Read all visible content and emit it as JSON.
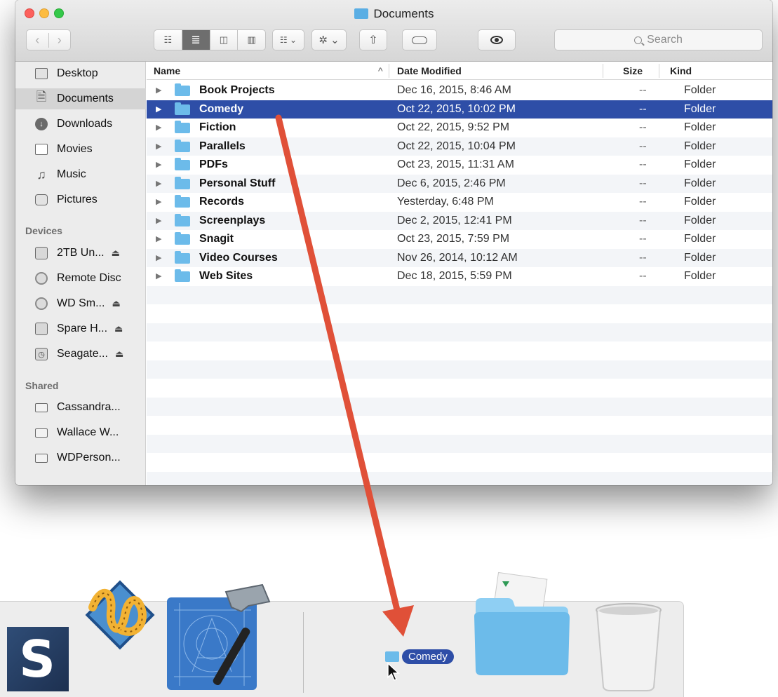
{
  "window": {
    "title": "Documents",
    "nav": {
      "back": "‹",
      "forward": "›"
    },
    "toolbar": {
      "view_icon": "☷",
      "list_icon": "≣",
      "column_icon": "◫",
      "cover_icon": "▥",
      "arrange": "☷ ⌄",
      "action": "✲ ⌄",
      "share": "⇧"
    },
    "search": {
      "placeholder": "Search"
    }
  },
  "sidebar": {
    "favorites": [
      {
        "label": "Desktop",
        "icon": "desktop-icon",
        "selected": false
      },
      {
        "label": "Documents",
        "icon": "documents-icon",
        "selected": true
      },
      {
        "label": "Downloads",
        "icon": "downloads-icon",
        "selected": false
      },
      {
        "label": "Movies",
        "icon": "movies-icon",
        "selected": false
      },
      {
        "label": "Music",
        "icon": "music-icon",
        "selected": false
      },
      {
        "label": "Pictures",
        "icon": "pictures-icon",
        "selected": false
      }
    ],
    "devices_header": "Devices",
    "devices": [
      {
        "label": "2TB Un...",
        "icon": "hard-drive-icon",
        "eject": "⏏"
      },
      {
        "label": "Remote Disc",
        "icon": "disc-icon",
        "eject": ""
      },
      {
        "label": "WD Sm...",
        "icon": "disc-icon",
        "eject": "⏏"
      },
      {
        "label": "Spare H...",
        "icon": "hard-drive-icon",
        "eject": "⏏"
      },
      {
        "label": "Seagate...",
        "icon": "time-machine-icon",
        "eject": "⏏"
      }
    ],
    "shared_header": "Shared",
    "shared": [
      {
        "label": "Cassandra...",
        "icon": "computer-icon"
      },
      {
        "label": "Wallace W...",
        "icon": "computer-icon"
      },
      {
        "label": "WDPerson...",
        "icon": "computer-icon"
      }
    ]
  },
  "list": {
    "columns": {
      "name": "Name",
      "date": "Date Modified",
      "size": "Size",
      "kind": "Kind",
      "sort_indicator": "^"
    },
    "rows": [
      {
        "name": "Book Projects",
        "date": "Dec 16, 2015, 8:46 AM",
        "size": "--",
        "kind": "Folder"
      },
      {
        "name": "Comedy",
        "date": "Oct 22, 2015, 10:02 PM",
        "size": "--",
        "kind": "Folder",
        "selected": true
      },
      {
        "name": "Fiction",
        "date": "Oct 22, 2015, 9:52 PM",
        "size": "--",
        "kind": "Folder"
      },
      {
        "name": "Parallels",
        "date": "Oct 22, 2015, 10:04 PM",
        "size": "--",
        "kind": "Folder"
      },
      {
        "name": "PDFs",
        "date": "Oct 23, 2015, 11:31 AM",
        "size": "--",
        "kind": "Folder"
      },
      {
        "name": "Personal Stuff",
        "date": "Dec 6, 2015, 2:46 PM",
        "size": "--",
        "kind": "Folder"
      },
      {
        "name": "Records",
        "date": "Yesterday, 6:48 PM",
        "size": "--",
        "kind": "Folder"
      },
      {
        "name": "Screenplays",
        "date": "Dec 2, 2015, 12:41 PM",
        "size": "--",
        "kind": "Folder"
      },
      {
        "name": "Snagit",
        "date": "Oct 23, 2015, 7:59 PM",
        "size": "--",
        "kind": "Folder"
      },
      {
        "name": "Video Courses",
        "date": "Nov 26, 2014, 10:12 AM",
        "size": "--",
        "kind": "Folder"
      },
      {
        "name": "Web Sites",
        "date": "Dec 18, 2015, 5:59 PM",
        "size": "--",
        "kind": "Folder"
      }
    ],
    "empty_rows": 11
  },
  "dock": {
    "apps": [
      {
        "name": "snagit-icon",
        "glyph": "S"
      },
      {
        "name": "wow-icon"
      },
      {
        "name": "xcode-icon"
      }
    ],
    "drag_label": "Comedy",
    "stack": "documents-stack-icon",
    "trash": "trash-icon"
  },
  "colors": {
    "selection": "#2e4ea7",
    "folder": "#6cbbea",
    "arrow": "#e05038",
    "sidebar": "#ececec"
  }
}
